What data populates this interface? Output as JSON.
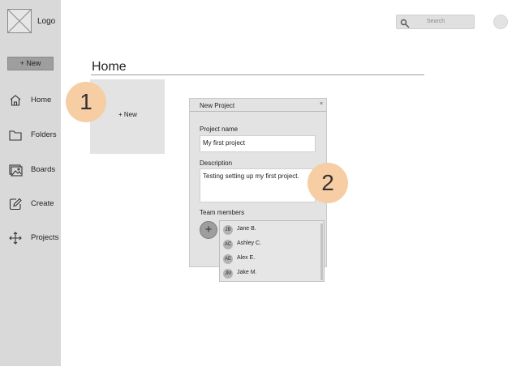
{
  "sidebar": {
    "logo_text": "Logo",
    "new_button": "+ New",
    "items": [
      {
        "label": "Home",
        "icon": "home-icon"
      },
      {
        "label": "Folders",
        "icon": "folder-icon"
      },
      {
        "label": "Boards",
        "icon": "image-icon"
      },
      {
        "label": "Create",
        "icon": "edit-icon"
      },
      {
        "label": "Projects",
        "icon": "move-icon"
      }
    ]
  },
  "header": {
    "search_placeholder": "Search"
  },
  "main": {
    "title": "Home",
    "new_card_label": "+ New"
  },
  "callouts": {
    "one": "1",
    "two": "2"
  },
  "dialog": {
    "title": "New Project",
    "close": "×",
    "project_name_label": "Project name",
    "project_name_value": "My first project",
    "description_label": "Description",
    "description_value": "Testing setting up my first project.",
    "team_members_label": "Team members",
    "add_member": "+"
  },
  "members_dropdown": {
    "items": [
      {
        "initials": "JB",
        "name": "Jane B."
      },
      {
        "initials": "AC",
        "name": "Ashley C."
      },
      {
        "initials": "AE",
        "name": "Alex E."
      },
      {
        "initials": "JM",
        "name": "Jake M."
      }
    ]
  }
}
